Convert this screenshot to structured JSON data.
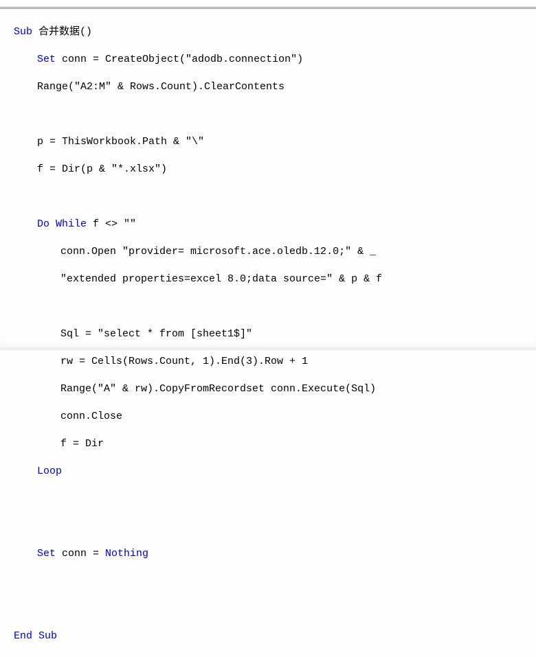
{
  "code": {
    "line1_kw": "Sub",
    "line1_rest": " 合并数据()",
    "line2_kw": "Set",
    "line2_rest": " conn = CreateObject(\"adodb.connection\")",
    "line3": "Range(\"A2:M\" & Rows.Count).ClearContents",
    "line4": "p = ThisWorkbook.Path & \"\\\"",
    "line5": "f = Dir(p & \"*.xlsx\")",
    "line6_kw1": "Do",
    "line6_mid": " ",
    "line6_kw2": "While",
    "line6_rest": " f <> \"\"",
    "line7": "conn.Open \"provider= microsoft.ace.oledb.12.0;\" & _",
    "line8": "\"extended properties=excel 8.0;data source=\" & p & f",
    "line9": "Sql = \"select * from [sheet1$]\"",
    "line10": "rw = Cells(Rows.Count, 1).End(3).Row + 1",
    "line11": "Range(\"A\" & rw).CopyFromRecordset conn.Execute(Sql)",
    "line12": "conn.Close",
    "line13": "f = Dir",
    "line14_kw": "Loop",
    "line15_kw": "Set",
    "line15_mid": " conn = ",
    "line15_kw2": "Nothing",
    "line16_kw": "End Sub"
  }
}
